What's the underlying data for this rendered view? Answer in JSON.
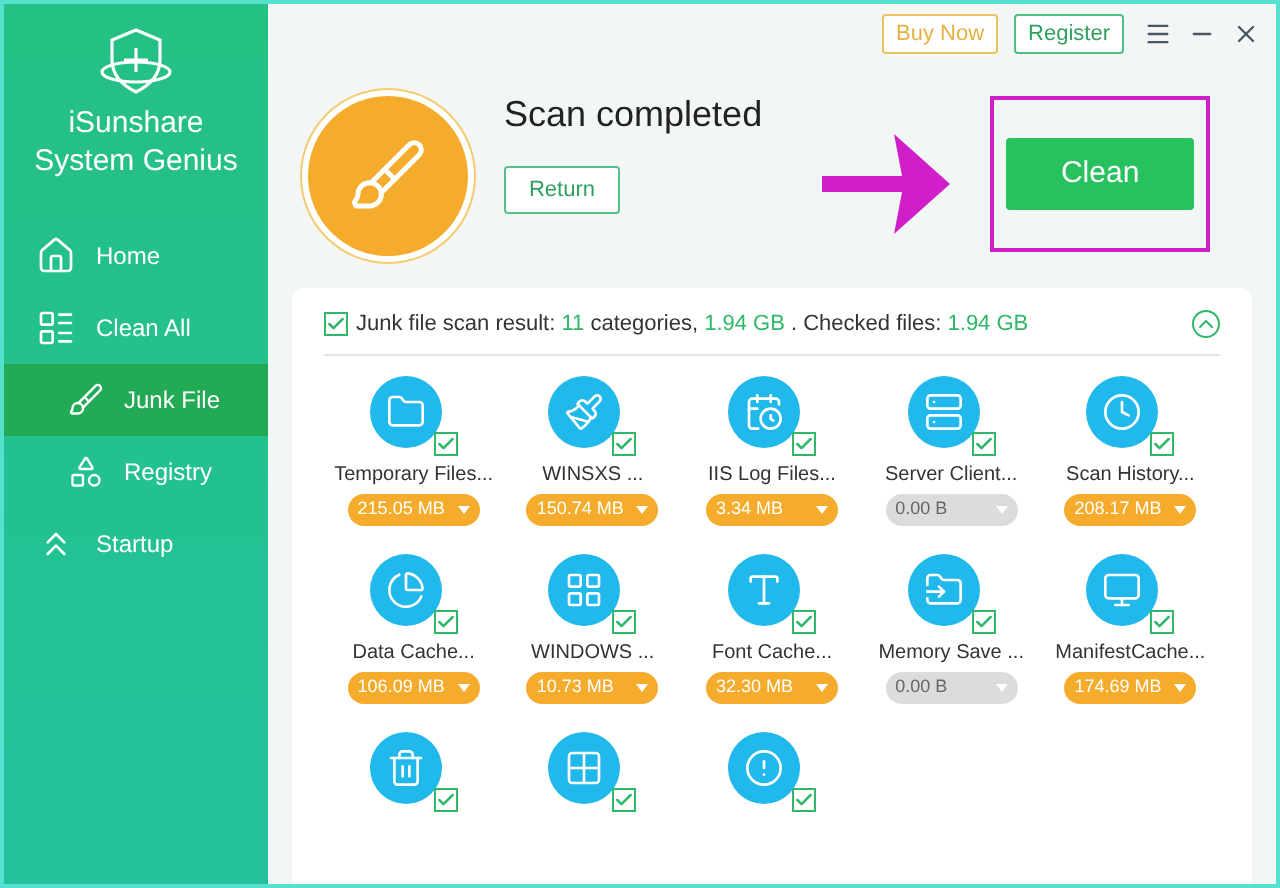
{
  "app": {
    "name_line1": "iSunshare",
    "name_line2": "System Genius"
  },
  "sidebar": {
    "items": [
      {
        "label": "Home",
        "selected": false
      },
      {
        "label": "Clean All",
        "selected": false,
        "children": [
          {
            "label": "Junk File",
            "selected": true
          },
          {
            "label": "Registry",
            "selected": false
          }
        ]
      },
      {
        "label": "Startup",
        "selected": false
      }
    ]
  },
  "top_buttons": [
    "Buy Now",
    "Register"
  ],
  "status": {
    "title": "Scan completed",
    "return_button": "Return",
    "clean_button": "Clean"
  },
  "summary": {
    "checked": true,
    "lead": "Junk file scan result:",
    "count": "11",
    "mid": "categories,",
    "size": "1.94 GB",
    "sep": ". Checked files:",
    "checked_size": "1.94 GB",
    "expanded": true
  },
  "categories": [
    {
      "label": "Temporary Files...",
      "size": "215.05 MB",
      "checked": true,
      "disabled": false
    },
    {
      "label": "WINSXS ...",
      "size": "150.74 MB",
      "checked": true,
      "disabled": false
    },
    {
      "label": "IIS Log Files...",
      "size": "3.34 MB",
      "checked": true,
      "disabled": false
    },
    {
      "label": "Server Client...",
      "size": "0.00 B",
      "checked": true,
      "disabled": true
    },
    {
      "label": "Scan History...",
      "size": "208.17 MB",
      "checked": true,
      "disabled": false
    },
    {
      "label": "Data Cache...",
      "size": "106.09 MB",
      "checked": true,
      "disabled": false
    },
    {
      "label": "WINDOWS ...",
      "size": "10.73 MB",
      "checked": true,
      "disabled": false
    },
    {
      "label": "Font Cache...",
      "size": "32.30 MB",
      "checked": true,
      "disabled": false
    },
    {
      "label": "Memory Save ...",
      "size": "0.00 B",
      "checked": true,
      "disabled": true
    },
    {
      "label": "ManifestCache...",
      "size": "174.69 MB",
      "checked": true,
      "disabled": false
    },
    {
      "checked": true
    },
    {
      "checked": true
    },
    {
      "checked": true
    }
  ]
}
